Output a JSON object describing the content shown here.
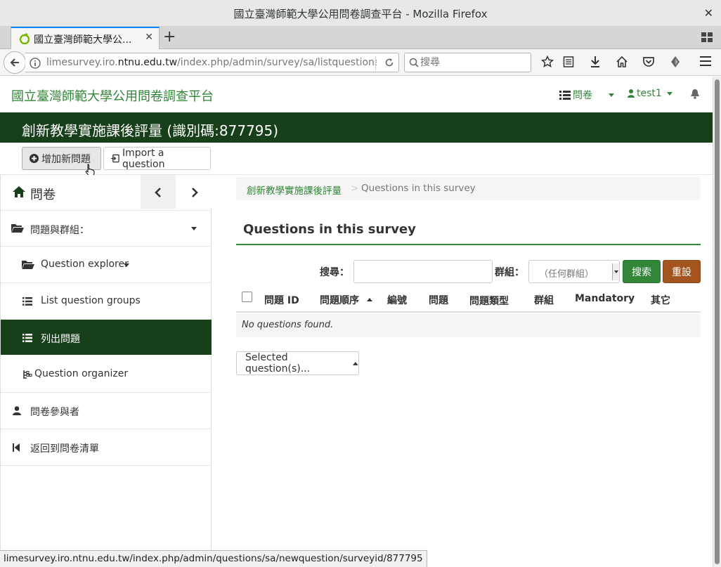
{
  "window": {
    "title": "國立臺灣師範大學公用問卷調查平台 - Mozilla Firefox",
    "close": "✕"
  },
  "tabs": [
    {
      "label": "國立臺灣師範大學公...",
      "close": "✕"
    }
  ],
  "newtab": "+",
  "navbar": {
    "url_prefix": "limesurvey.iro.",
    "url_domain": "ntnu.edu.tw",
    "url_path": "/index.php/admin/survey/sa/listquestions/s",
    "search_placeholder": "搜尋"
  },
  "site": {
    "name": "國立臺灣師範大學公用問卷調查平台",
    "menu_survey": "問卷",
    "menu_user": "test1"
  },
  "survey": {
    "title": "創新教學實施課後評量 (識別碼:877795)"
  },
  "actions": {
    "add_question": "增加新問題",
    "import_question": "Import a question"
  },
  "sidebar": {
    "home_label": "問卷",
    "groups_label": "問題與群組：",
    "items": [
      {
        "label": "Question explorer"
      },
      {
        "label": "List question groups"
      },
      {
        "label": "列出問題"
      },
      {
        "label": "Question organizer"
      },
      {
        "label": "問卷參與者"
      },
      {
        "label": "返回到問卷清單"
      }
    ]
  },
  "breadcrumb": {
    "survey": "創新教學實施課後評量",
    "separator": ">",
    "current": "Questions in this survey"
  },
  "main": {
    "title": "Questions in this survey",
    "search_label": "搜尋：",
    "group_label": "群組：",
    "group_select_value": "（任何群組）",
    "search_button": "搜索",
    "reset_button": "重設",
    "columns": [
      "問題 ID",
      "問題順序",
      "編號",
      "問題",
      "問題類型",
      "群組",
      "Mandatory",
      "其它"
    ],
    "empty_text": "No questions found.",
    "selected_button": "Selected question(s)..."
  },
  "status": {
    "link": "limesurvey.iro.ntnu.edu.tw/index.php/admin/questions/sa/newquestion/surveyid/877795"
  },
  "colors": {
    "brand_green": "#328637",
    "dark_green": "#173f1a",
    "reset_brown": "#a4541e"
  }
}
